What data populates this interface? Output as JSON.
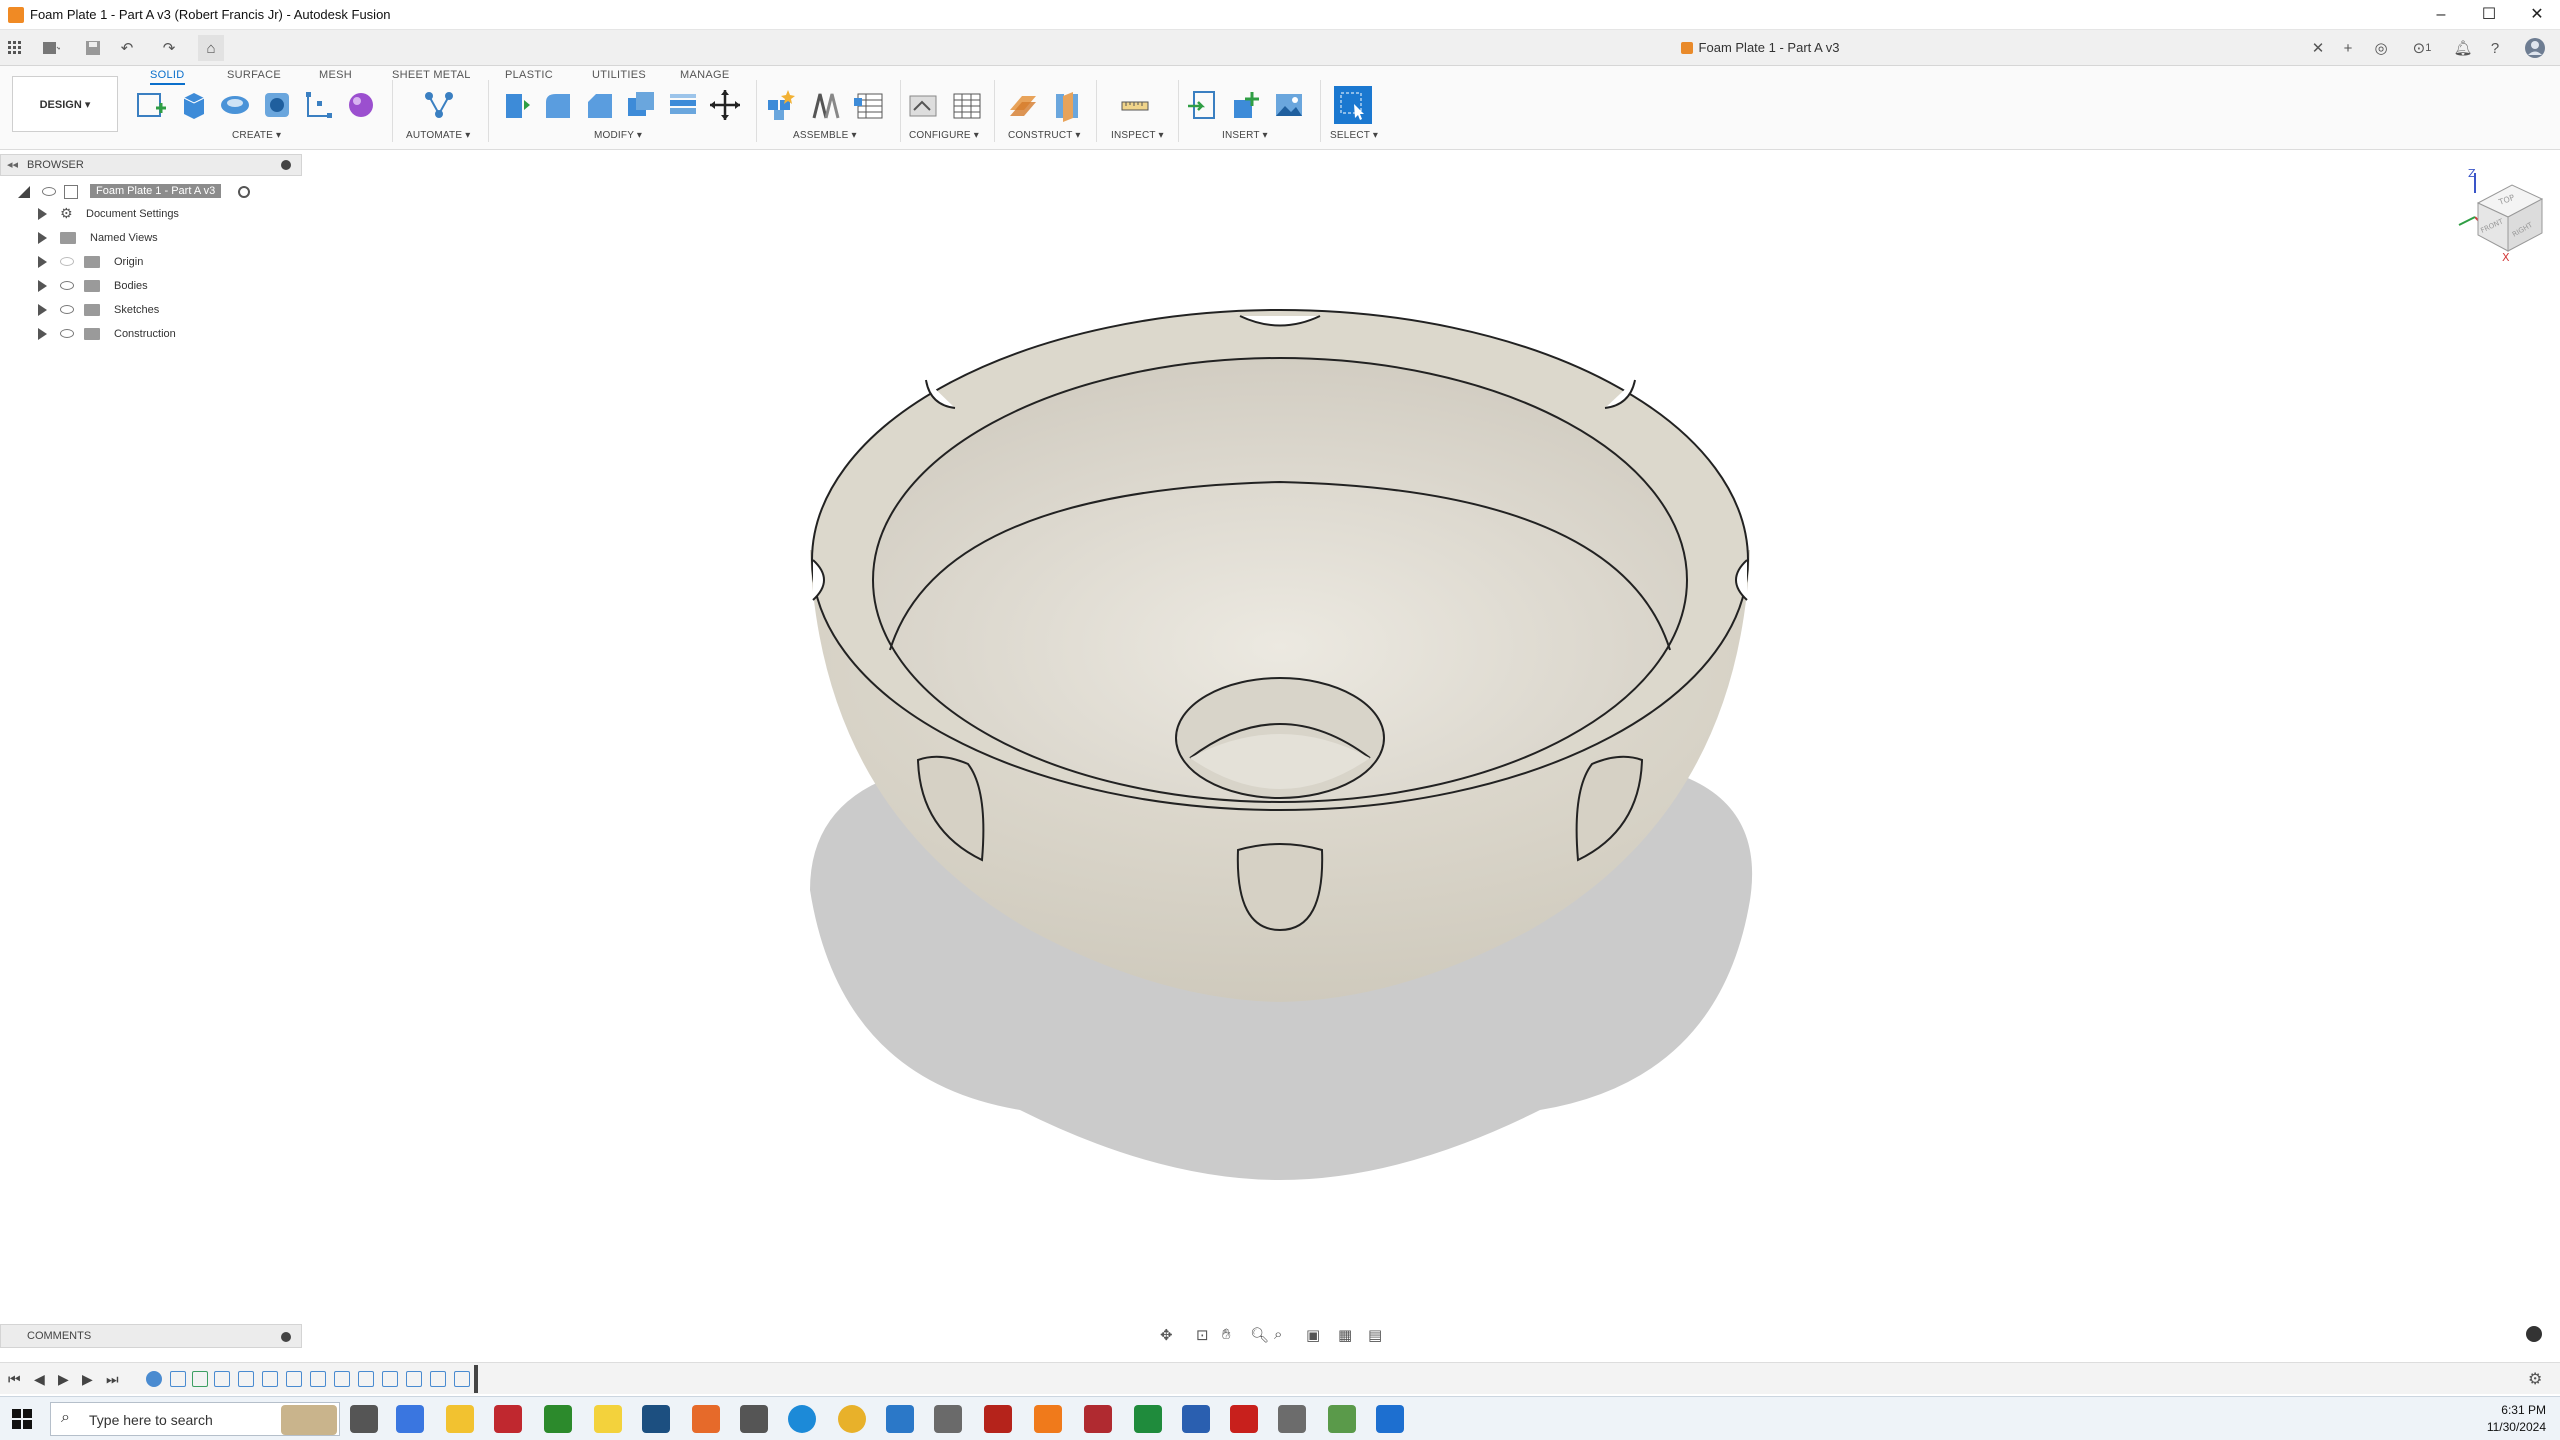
{
  "window": {
    "title": "Foam Plate 1 - Part A v3 (Robert Francis Jr) - Autodesk Fusion",
    "controls": [
      "–",
      "☐",
      "✕"
    ]
  },
  "appbar": {
    "document_tab": "Foam Plate 1 - Part A v3",
    "job_status": "1"
  },
  "ribbon": {
    "workspace": "DESIGN ▾",
    "tabs": [
      {
        "label": "SOLID",
        "active": true
      },
      {
        "label": "SURFACE"
      },
      {
        "label": "MESH"
      },
      {
        "label": "SHEET METAL"
      },
      {
        "label": "PLASTIC"
      },
      {
        "label": "UTILITIES"
      },
      {
        "label": "MANAGE"
      }
    ],
    "groups": {
      "create": "CREATE ▾",
      "automate": "AUTOMATE ▾",
      "modify": "MODIFY ▾",
      "assemble": "ASSEMBLE ▾",
      "configure": "CONFIGURE ▾",
      "construct": "CONSTRUCT ▾",
      "inspect": "INSPECT ▾",
      "insert": "INSERT ▾",
      "select": "SELECT ▾"
    }
  },
  "browser": {
    "title": "BROWSER",
    "root": "Foam Plate 1 - Part A v3",
    "items": [
      {
        "label": "Document Settings",
        "icon": "gear-icon"
      },
      {
        "label": "Named Views",
        "icon": "folder-icon"
      },
      {
        "label": "Origin",
        "icon": "folder-icon"
      },
      {
        "label": "Bodies",
        "icon": "folder-icon"
      },
      {
        "label": "Sketches",
        "icon": "folder-icon"
      },
      {
        "label": "Construction",
        "icon": "folder-icon"
      }
    ]
  },
  "viewcube": {
    "z": "Z",
    "x": "X",
    "faces": [
      "TOP",
      "FRONT",
      "RIGHT"
    ]
  },
  "comments": {
    "title": "COMMENTS"
  },
  "taskbar": {
    "search_placeholder": "Type here to search",
    "time": "6:31 PM",
    "date": "11/30/2024"
  },
  "colors": {
    "accent": "#0a6fcb",
    "model_fill": "#dcd8cc",
    "shadow": "#c9c9c9",
    "viewport": "#ffffff"
  }
}
